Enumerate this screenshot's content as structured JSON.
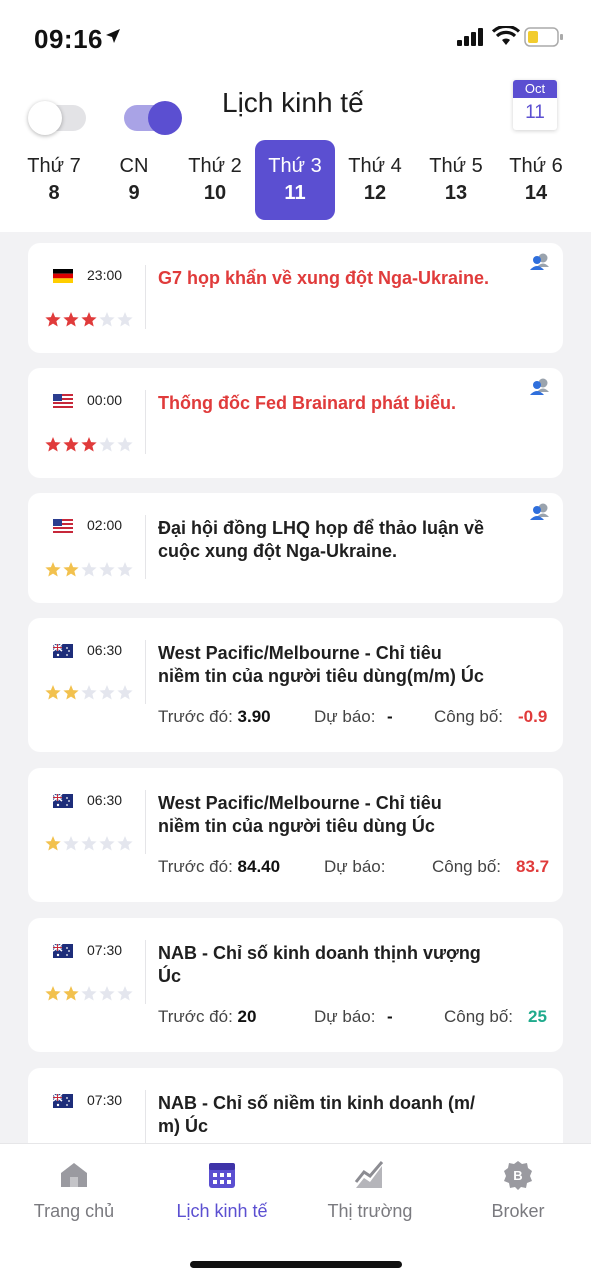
{
  "status_bar": {
    "time": "09:16"
  },
  "header": {
    "title": "Lịch kinh tế",
    "calendar_month": "Oct",
    "calendar_day": "11"
  },
  "days": [
    {
      "name": "Thứ 7",
      "date": "8"
    },
    {
      "name": "CN",
      "date": "9"
    },
    {
      "name": "Thứ 2",
      "date": "10"
    },
    {
      "name": "Thứ 3",
      "date": "11",
      "active": true
    },
    {
      "name": "Thứ 4",
      "date": "12"
    },
    {
      "name": "Thứ 5",
      "date": "13"
    },
    {
      "name": "Thứ 6",
      "date": "14"
    }
  ],
  "events": [
    {
      "flag": "DE",
      "time": "23:00",
      "title": "G7 họp khẩn về xung đột Nga-Ukraine.",
      "rating": 3,
      "star_color": "#e03b3b",
      "highlight": true
    },
    {
      "flag": "US",
      "time": "00:00",
      "title": "Thống đốc Fed Brainard phát biểu.",
      "rating": 3,
      "star_color": "#e03b3b",
      "highlight": true
    },
    {
      "flag": "US",
      "time": "02:00",
      "title_lines": [
        "Đại hội đồng LHQ họp để thảo luận về",
        "cuộc xung đột Nga-Ukraine."
      ],
      "rating": 2,
      "star_color": "#f2c14e"
    },
    {
      "flag": "AU",
      "time": "06:30",
      "title_lines": [
        "West Pacific/Melbourne - Chỉ tiêu",
        "niềm tin của người tiêu dùng(m/m) Úc"
      ],
      "rating": 2,
      "star_color": "#f2c14e",
      "previous_label": "Trước đó:",
      "previous": "3.90",
      "forecast_label": "Dự báo:",
      "forecast": "-",
      "actual_label": "Công bố:",
      "actual": "-0.9"
    },
    {
      "flag": "AU",
      "time": "06:30",
      "title_lines": [
        "West Pacific/Melbourne - Chỉ tiêu",
        "niềm tin của người tiêu dùng Úc"
      ],
      "rating": 1,
      "star_color": "#f2c14e",
      "previous_label": "Trước đó:",
      "previous": "84.40",
      "forecast_label": "Dự báo:",
      "forecast": "",
      "actual_label": "Công bố:",
      "actual": "83.7"
    },
    {
      "flag": "AU",
      "time": "07:30",
      "title_lines": [
        "NAB - Chỉ số kinh doanh thịnh vượng",
        "Úc"
      ],
      "rating": 2,
      "star_color": "#f2c14e",
      "previous_label": "Trước đó:",
      "previous": "20",
      "forecast_label": "Dự báo:",
      "forecast": "-",
      "actual_label": "Công bố:",
      "actual": "25"
    },
    {
      "flag": "AU",
      "time": "07:30",
      "title_lines": [
        "NAB - Chỉ số niềm tin kinh doanh (m/",
        "m) Úc"
      ]
    }
  ],
  "tabs": [
    {
      "label": "Trang chủ",
      "icon": "home-icon"
    },
    {
      "label": "Lịch kinh tế",
      "icon": "calendar-icon",
      "active": true
    },
    {
      "label": "Thị trường",
      "icon": "chart-icon"
    },
    {
      "label": "Broker",
      "icon": "broker-icon"
    }
  ],
  "colors": {
    "accent": "#5b4fd1",
    "negative": "#e03b3b",
    "positive": "#1faa8c",
    "star_high": "#e03b3b",
    "star_mid": "#f2c14e"
  }
}
